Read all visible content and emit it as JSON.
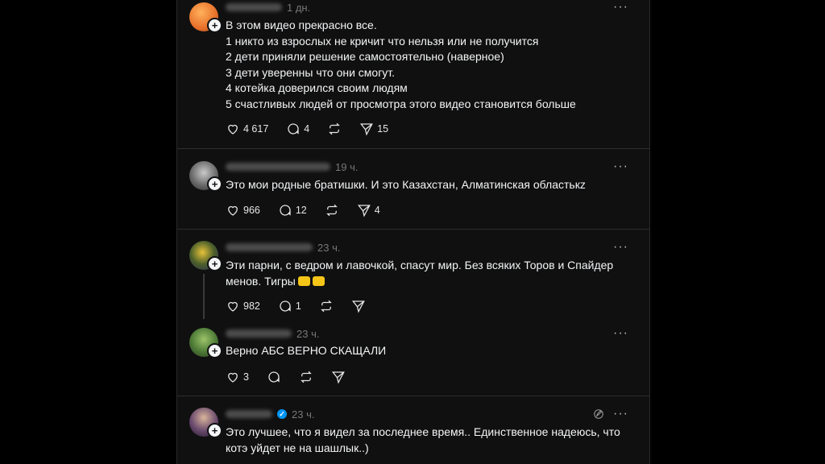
{
  "posts": [
    {
      "time": "1 дн.",
      "body": "В этом видео прекрасно все.\n1 никто из взрослых не кричит что нельзя или не получится\n2 дети приняли решение самостоятельно (наверное)\n3 дети уверенны что они смогут.\n4 котейка доверился своим людям\n5 счастливых людей от просмотра этого видео становится больше",
      "likes": "4 617",
      "replies": "4",
      "shares": "15"
    },
    {
      "time": "19 ч.",
      "body": "Это мои родные братишки. И это Казахстан, Алматинская областькz",
      "likes": "966",
      "replies": "12",
      "shares": "4"
    },
    {
      "time": "23 ч.",
      "body": "Эти парни, с ведром и лавочкой, спасут мир. Без всяких Торов и Спайдер\nменов. Тигры",
      "likes": "982",
      "replies": "1",
      "shares": ""
    },
    {
      "time": "23 ч.",
      "body": "Верно АБС ВЕРНО СКАЩАЛИ",
      "likes": "3",
      "replies": "",
      "shares": ""
    },
    {
      "time": "23 ч.",
      "body": "Это лучшее, что я видел за последнее время.. Единственное надеюсь, что\nкотэ уйдет не на шашлык..)"
    }
  ],
  "icons": {
    "more": "more-icon",
    "like": "heart-icon",
    "reply": "comment-icon",
    "repost": "repost-icon",
    "share": "send-icon",
    "follow": "plus-icon",
    "verified": "verified-icon",
    "edit": "edit-icon"
  },
  "colors": {
    "background": "#101010",
    "text": "#f3f5f7",
    "muted": "#777777",
    "verified": "#0095f6"
  }
}
